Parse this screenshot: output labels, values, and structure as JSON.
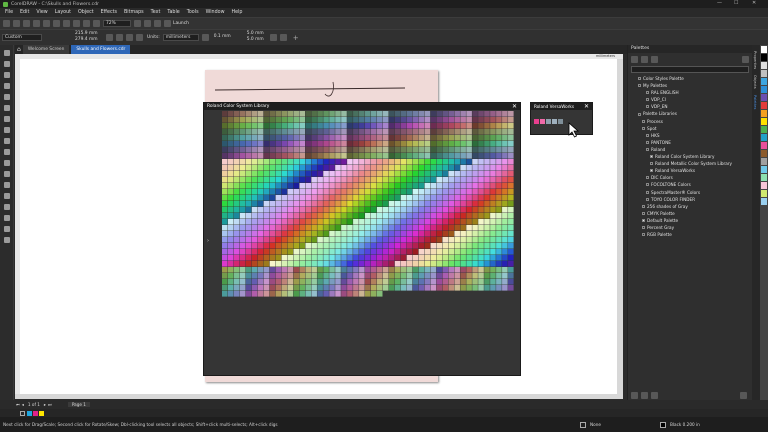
{
  "window": {
    "title": "CorelDRAW - C:\\Skulls and Flowers.cdr",
    "controls": [
      "—",
      "☐",
      "✕"
    ]
  },
  "menu": [
    "File",
    "Edit",
    "View",
    "Layout",
    "Object",
    "Effects",
    "Bitmaps",
    "Text",
    "Table",
    "Tools",
    "Window",
    "Help"
  ],
  "toolbar": {
    "zoom": "72%",
    "launch_label": "Launch"
  },
  "property_bar": {
    "preset": "Custom",
    "width": "215.9 mm",
    "height": "279.4 mm",
    "units_label": "Units:",
    "units": "millimeters",
    "nudge": "0.1 mm",
    "dup_x": "5.0 mm",
    "dup_y": "5.0 mm"
  },
  "tabs": [
    {
      "label": "Welcome Screen",
      "active": false
    },
    {
      "label": "Skulls and Flowers.cdr",
      "active": true
    }
  ],
  "ruler_unit": "millimeters",
  "dialogs": {
    "roland_color_system": {
      "title": "Roland Color System Library",
      "close": "✕"
    },
    "roland_versaworks": {
      "title": "Roland VersaWorks",
      "close": "✕",
      "swatches": [
        "#e83f8f",
        "#f06aa8",
        "#8fa0ad",
        "#9fb0bd",
        "#7f8f99"
      ]
    }
  },
  "palettes_panel": {
    "title": "Palettes",
    "tree": [
      {
        "label": "Color Styles Palette",
        "indent": 1,
        "check": false
      },
      {
        "label": "My Palettes",
        "indent": 1,
        "check": false
      },
      {
        "label": "RAL ENGLISH",
        "indent": 3,
        "check": false
      },
      {
        "label": "VDP_CI",
        "indent": 3,
        "check": false
      },
      {
        "label": "VDP_EN",
        "indent": 3,
        "check": false
      },
      {
        "label": "Palette Libraries",
        "indent": 1,
        "check": false
      },
      {
        "label": "Process",
        "indent": 2,
        "check": false
      },
      {
        "label": "Spot",
        "indent": 2,
        "check": false
      },
      {
        "label": "HKS",
        "indent": 3,
        "check": false
      },
      {
        "label": "PANTONE",
        "indent": 3,
        "check": false
      },
      {
        "label": "Roland",
        "indent": 3,
        "check": false
      },
      {
        "label": "Roland Color System Library",
        "indent": 4,
        "check": true
      },
      {
        "label": "Roland Metallic Color System Library",
        "indent": 4,
        "check": false
      },
      {
        "label": "Roland VersaWorks",
        "indent": 4,
        "check": true
      },
      {
        "label": "DIC Colors",
        "indent": 3,
        "check": false
      },
      {
        "label": "FOCOLTONE Colors",
        "indent": 3,
        "check": false
      },
      {
        "label": "SpectraMaster® Colors",
        "indent": 3,
        "check": false
      },
      {
        "label": "TOYO COLOR FINDER",
        "indent": 3,
        "check": false
      },
      {
        "label": "256 shades of Gray",
        "indent": 2,
        "check": false
      },
      {
        "label": "CMYK Palette",
        "indent": 2,
        "check": false
      },
      {
        "label": "Default Palette",
        "indent": 2,
        "check": true
      },
      {
        "label": "Percent Gray",
        "indent": 2,
        "check": false
      },
      {
        "label": "RGB Palette",
        "indent": 2,
        "check": false
      }
    ],
    "side_tabs": [
      "Properties",
      "Objects",
      "Palettes"
    ]
  },
  "palette_strip": [
    "#ffffff",
    "#000000",
    "#e0e0e0",
    "#c0c0c0",
    "#3ea6e0",
    "#2d8fd6",
    "#6a4fb0",
    "#e23b3b",
    "#f4a020",
    "#ffe000",
    "#4caf50",
    "#22a0c8",
    "#e94f9b",
    "#8b5a2b",
    "#a0a0a0",
    "#6fc8e8",
    "#8de0b0",
    "#f7c6d8",
    "#d0e870",
    "#9ad0f0"
  ],
  "status": {
    "page_of": "1 of 1",
    "page_label": "Page 1",
    "fill_label": "None",
    "outline_label": "Black 0.200 in"
  },
  "hint": "Next click for Drag/Scale; Second click for Rotate/Skew; Dbl-clicking tool selects all objects; Shift+click multi-selects; Alt+click digs"
}
